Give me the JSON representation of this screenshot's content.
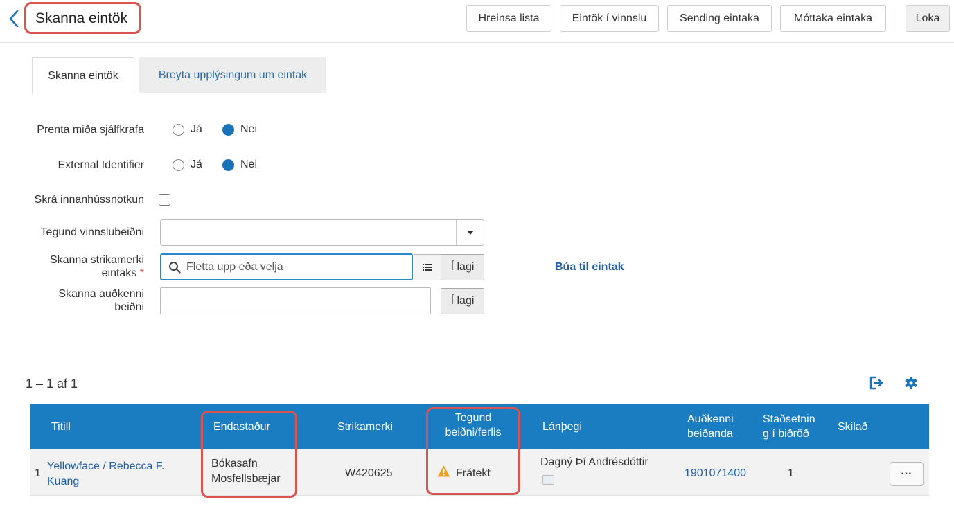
{
  "header": {
    "title": "Skanna eintök",
    "buttons": {
      "clear_list": "Hreinsa lista",
      "in_process": "Eintök í vinnslu",
      "send_items": "Sending eintaka",
      "receive_items": "Móttaka eintaka",
      "close": "Loka"
    }
  },
  "tabs": [
    {
      "label": "Skanna eintök",
      "active": true
    },
    {
      "label": "Breyta upplýsingum um eintak",
      "active": false
    }
  ],
  "form": {
    "print_slip": {
      "label": "Prenta miða sjálfkrafa",
      "yes": "Já",
      "no": "Nei",
      "selected": "Nei"
    },
    "external_identifier": {
      "label": "External Identifier",
      "yes": "Já",
      "no": "Nei",
      "selected": "Nei"
    },
    "in_house_use": {
      "label": "Skrá innanhússnotkun",
      "checked": false
    },
    "work_order_type": {
      "label": "Tegund vinnslubeiðni",
      "value": ""
    },
    "scan_barcode": {
      "label_line1": "Skanna strikamerki",
      "label_line2": "eintaks",
      "required_mark": "*",
      "placeholder": "Fletta upp eða velja",
      "ok": "Í lagi"
    },
    "scan_request": {
      "label_line1": "Skanna auðkenni",
      "label_line2": "beiðni",
      "value": "",
      "ok": "Í lagi"
    },
    "create_item_link": "Búa til eintak"
  },
  "results": {
    "count": "1 – 1 af 1",
    "columns": {
      "title": "Titill",
      "destination": "Endastaður",
      "barcode": "Strikamerki",
      "request_type_l1": "Tegund",
      "request_type_l2": "beiðni/ferlis",
      "requester": "Lánþegi",
      "requester_id_l1": "Auðkenni",
      "requester_id_l2": "beiðanda",
      "queue_l1": "Staðsetnin",
      "queue_l2": "g í biðröð",
      "returned": "Skilað"
    },
    "rows": [
      {
        "index": "1",
        "title_l1": "Yellowface / Rebecca F.",
        "title_l2": "Kuang",
        "destination_l1": "Bókasafn",
        "destination_l2": "Mosfellsbæjar",
        "barcode": "W420625",
        "request_type": "Frátekt",
        "requester": "Dagný Þí Andrésdóttir",
        "requester_id": "1901071400",
        "queue_position": "1",
        "returned": "",
        "more": "···"
      }
    ]
  },
  "colors": {
    "primary": "#1a7cc1",
    "link": "#1f5fa8",
    "highlight": "#d9534f",
    "warning": "#f0a020"
  }
}
